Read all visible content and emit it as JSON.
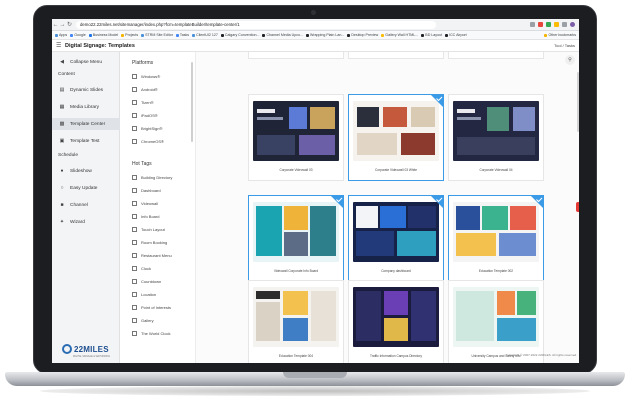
{
  "browser": {
    "url": "demo22.22miles.net/sitemanager/index.php?fcm=templateBuilder/template-center/1",
    "bookmarks": [
      "Apps",
      "Google",
      "Business Model",
      "Projects",
      "STRM Site Editor",
      "Tasks",
      "ClientUI2 127",
      "Calgary Convention...",
      "Channel Media Upco...",
      "Wrapping Plain Lan...",
      "Desktop Preview",
      "Gallery Wall HTML...",
      "BD Layout",
      "ICC Airport"
    ],
    "other_bookmarks": "Other bookmarks"
  },
  "app": {
    "title": "Digital Signage: Templates",
    "tool_link": "Tool / Tasks"
  },
  "sidebar": {
    "collapse": "Collapse Menu",
    "content_head": "Content",
    "items": [
      {
        "label": "Dynamic Slides",
        "icon": "slides-icon"
      },
      {
        "label": "Media Library",
        "icon": "media-icon"
      },
      {
        "label": "Template Center",
        "icon": "template-icon"
      },
      {
        "label": "Template Test",
        "icon": "test-icon"
      }
    ],
    "schedule_head": "Schedule",
    "schedule_items": [
      {
        "label": "Slideshow",
        "icon": "slideshow-icon"
      },
      {
        "label": "Easy Update",
        "icon": "update-icon"
      },
      {
        "label": "Channel",
        "icon": "channel-icon"
      },
      {
        "label": "Wizard",
        "icon": "wizard-icon"
      }
    ],
    "brand": "22MILES",
    "brand_tagline": "DIGITAL SIGNAGE & WAYFINDING"
  },
  "filters": {
    "platforms_head": "Platforms",
    "platforms": [
      "Windows®",
      "Android®",
      "Tizen®",
      "iPadOS®",
      "BrightSign®",
      "ChromeOS®"
    ],
    "tags_head": "Hot Tags",
    "tags": [
      "Building Directory",
      "Dashboard",
      "Videowall",
      "Info Board",
      "Touch Layout",
      "Room Booking",
      "Restaurant Menu",
      "Clock",
      "Countdown",
      "Location",
      "Point of Interests",
      "Gallery",
      "The World Clock"
    ]
  },
  "gallery": {
    "cards": [
      {
        "caption": "Corporate Videowall 03",
        "selected": false,
        "theme": "dark"
      },
      {
        "caption": "Corporate Videowall 03 White",
        "selected": true,
        "theme": "light"
      },
      {
        "caption": "Corporate Videowall 04",
        "selected": false,
        "theme": "dark"
      },
      {
        "caption": "Videowall Corporate Info Board",
        "selected": true,
        "theme": "teal"
      },
      {
        "caption": "Company dashboard",
        "selected": true,
        "theme": "navy"
      },
      {
        "caption": "Education Template 002",
        "selected": true,
        "theme": "mixed"
      },
      {
        "caption": "Education Template 004",
        "selected": false,
        "theme": "edu"
      },
      {
        "caption": "Traffic Information Campus Directory",
        "selected": false,
        "theme": "night"
      },
      {
        "caption": "University Campus and Safety Info",
        "selected": false,
        "theme": "campus"
      }
    ],
    "copyright": "Copyright © 2007-2022 22MILES. All rights reserved."
  },
  "colors": {
    "accent": "#3c9be6",
    "brand": "#1d4e8f",
    "sidebar_bg": "#f3f4f6"
  }
}
